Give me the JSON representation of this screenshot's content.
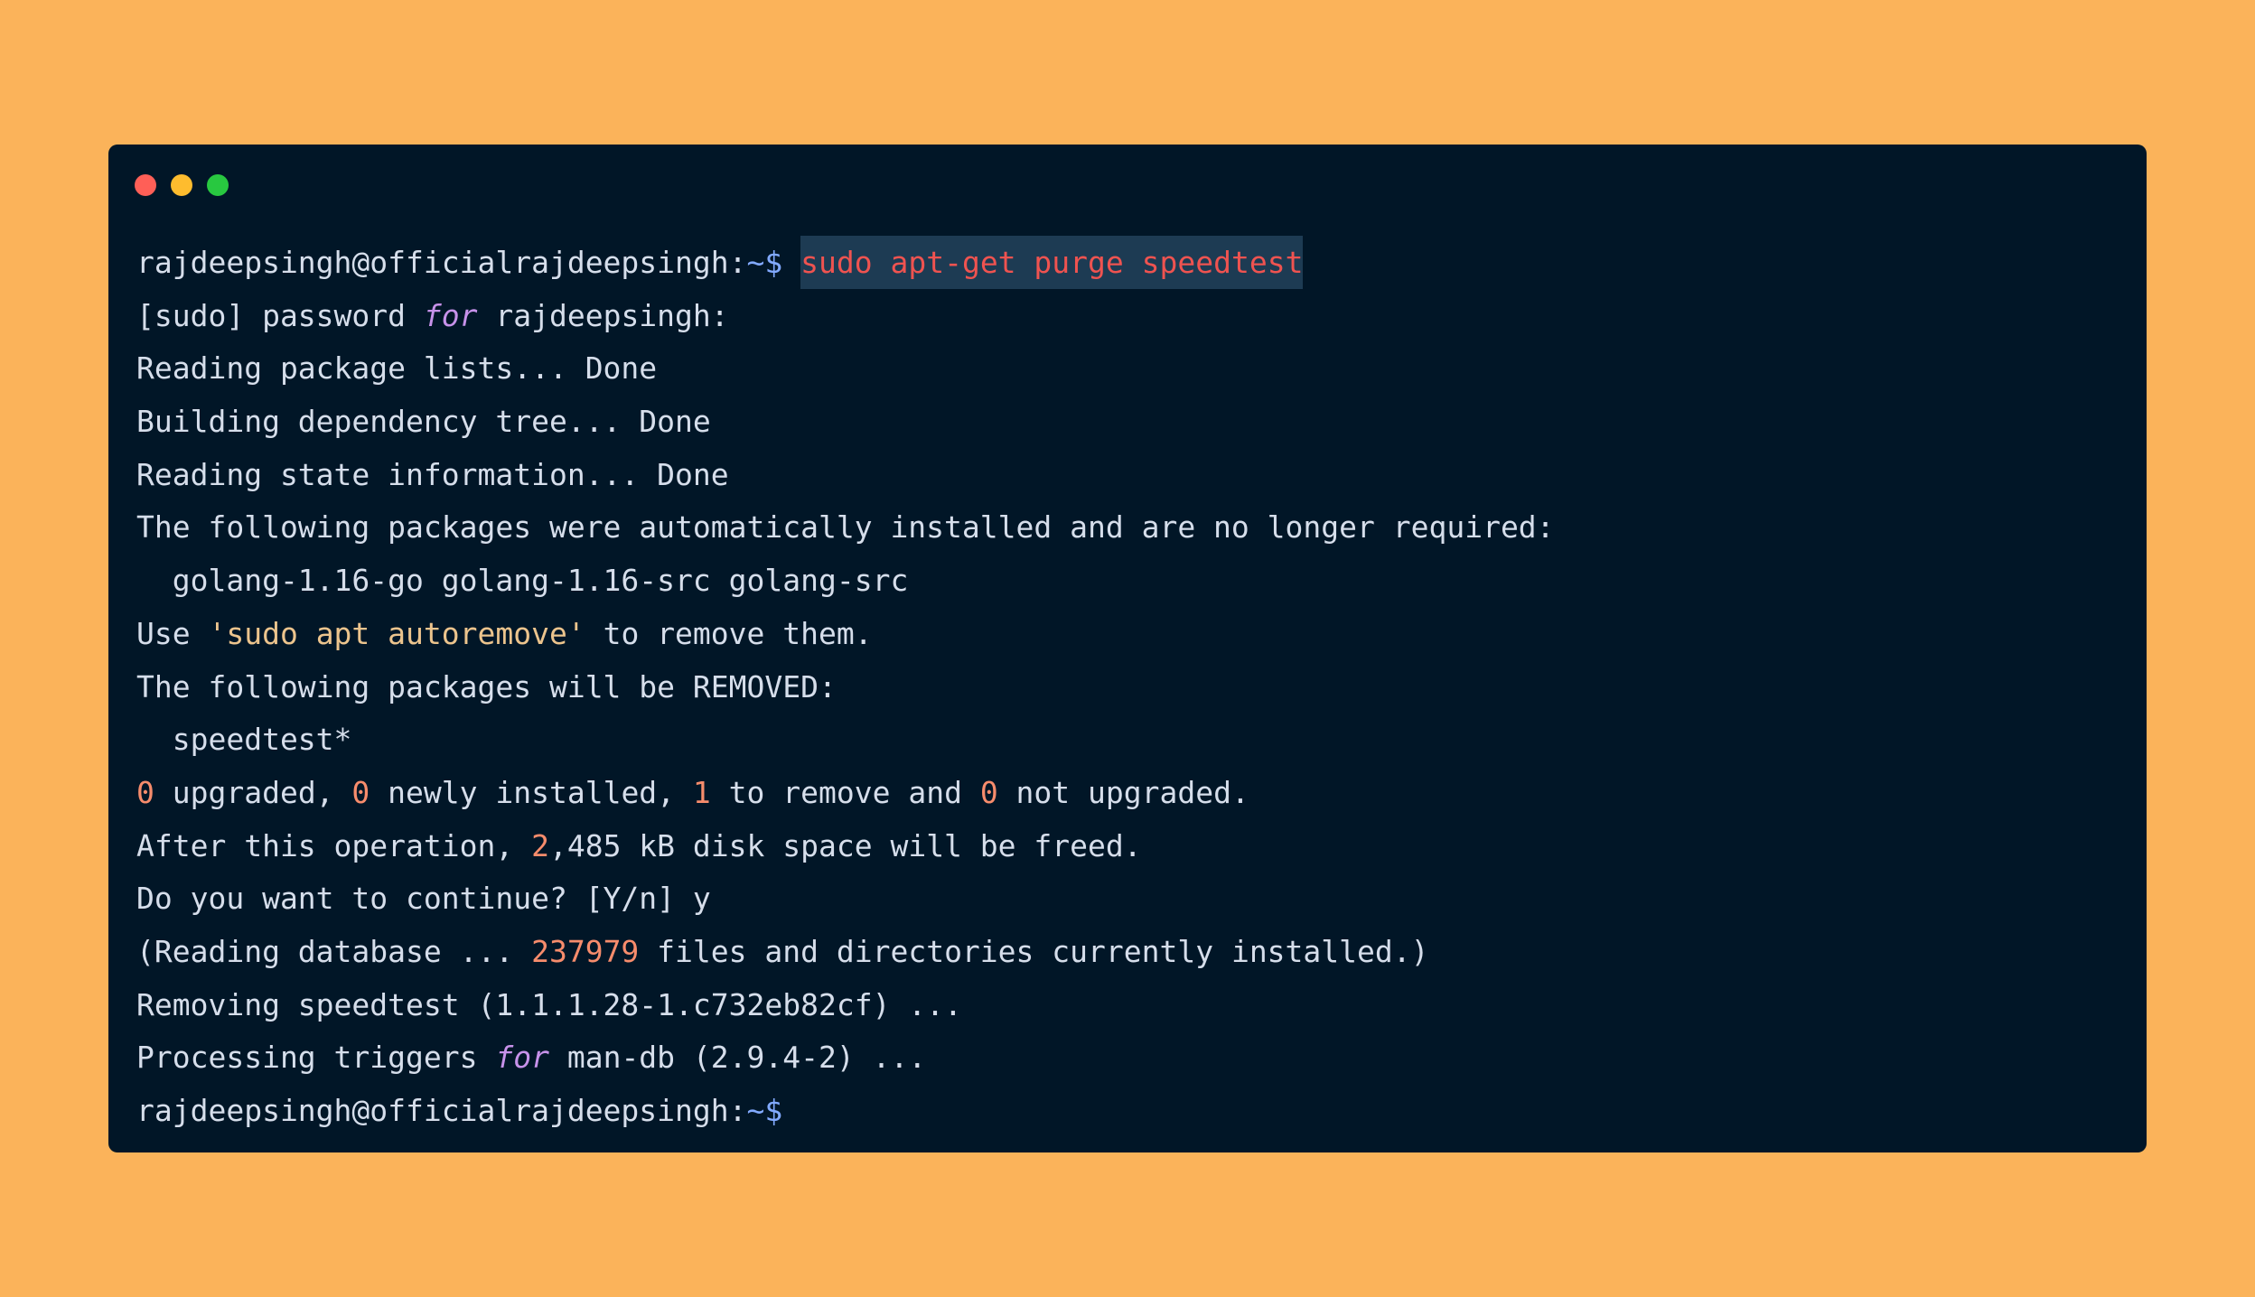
{
  "background_color": "#fbb35a",
  "terminal": {
    "background_color": "#011627",
    "window_controls": [
      "close",
      "minimize",
      "maximize"
    ],
    "prompt": {
      "user_host": "rajdeepsingh@officialrajdeepsingh:",
      "symbol": "~$"
    },
    "command": "sudo apt-get purge speedtest",
    "lines": {
      "l2": {
        "a": "[sudo] password ",
        "kw": "for",
        "b": " rajdeepsingh:"
      },
      "l3": "Reading package lists... Done",
      "l4": "Building dependency tree... Done",
      "l5": "Reading state information... Done",
      "l6": "The following packages were automatically installed and are no longer required:",
      "l7": "  golang-1.16-go golang-1.16-src golang-src",
      "l8": {
        "a": "Use ",
        "str": "'sudo apt autoremove'",
        "b": " to remove them."
      },
      "l9": "The following packages will be REMOVED:",
      "l10": "  speedtest*",
      "l11": {
        "n1": "0",
        "t1": " upgraded, ",
        "n2": "0",
        "t2": " newly installed, ",
        "n3": "1",
        "t3": " to remove and ",
        "n4": "0",
        "t4": " not upgraded."
      },
      "l12": {
        "a": "After this operation, ",
        "n": "2",
        "b": ",485 kB disk space will be freed."
      },
      "l13": "Do you want to continue? [Y/n] y",
      "l14": {
        "a": "(Reading database ... ",
        "n": "237979",
        "b": " files and directories currently installed.)"
      },
      "l15": "Removing speedtest (1.1.1.28-1.c732eb82cf) ...",
      "l16": {
        "a": "Processing triggers ",
        "kw": "for",
        "b": " man-db (2.9.4-2) ..."
      }
    }
  }
}
